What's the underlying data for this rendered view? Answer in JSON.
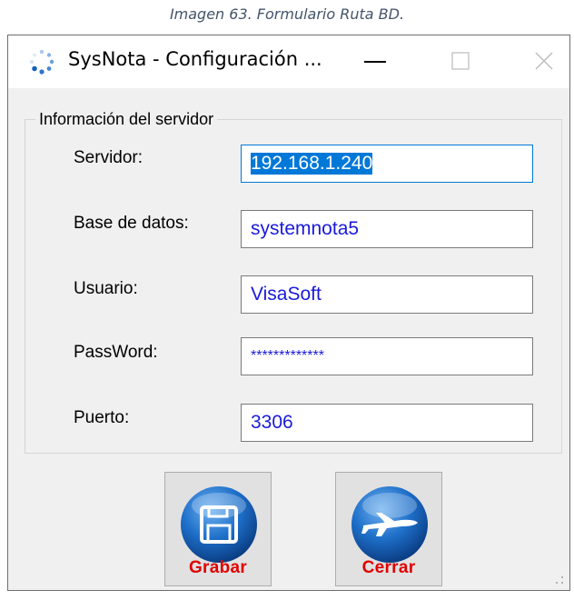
{
  "caption": "Imagen 63. Formulario Ruta BD.",
  "window": {
    "title": "SysNota - Configuración ...",
    "app_icon": "spinner-dots-icon",
    "controls": {
      "minimize": "minimize-icon",
      "maximize": "maximize-icon",
      "close": "close-icon"
    }
  },
  "group": {
    "legend": "Información del servidor",
    "fields": [
      {
        "label": "Servidor:",
        "value": "192.168.1.240",
        "focused": true,
        "selected": true
      },
      {
        "label": "Base de datos:",
        "value": "systemnota5"
      },
      {
        "label": "Usuario:",
        "value": "VisaSoft"
      },
      {
        "label": "PassWord:",
        "value": "*************"
      },
      {
        "label": "Puerto:",
        "value": "3306"
      }
    ]
  },
  "buttons": {
    "save": {
      "label": "Grabar",
      "icon": "floppy-disk-icon"
    },
    "close": {
      "label": "Cerrar",
      "icon": "airplane-icon"
    }
  },
  "colors": {
    "input_text": "#1a1adb",
    "button_label": "#e00000",
    "selection": "#0078d7",
    "icon_blue": "#1565c0"
  }
}
